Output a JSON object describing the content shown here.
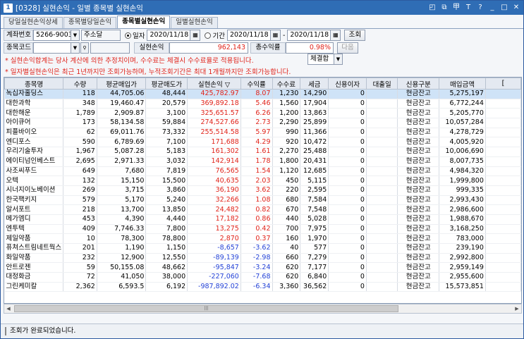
{
  "window": {
    "title": "[0328] 실현손익 - 일별 종목별 실현손익",
    "app_badge": "1"
  },
  "titlebar_icons": [
    "restore-icon",
    "copy-icon",
    "pin-icon",
    "font-icon",
    "help-icon",
    "minimize-icon",
    "maximize-icon",
    "close-icon"
  ],
  "titlebar_glyphs": {
    "t1": "◰",
    "t2": "⧉",
    "t3": "甲",
    "t4": "T",
    "t5": "?",
    "min": "_",
    "max": "□",
    "close": "✕"
  },
  "tabs": [
    {
      "label": "당일실현손익상세"
    },
    {
      "label": "종목별당일손익"
    },
    {
      "label": "종목별실현손익",
      "active": true
    },
    {
      "label": "일별실현손익"
    }
  ],
  "filters": {
    "account_label": "계좌번호",
    "account_value": "5266-9003",
    "account_holder": "주소달",
    "radio_daily": "일자",
    "radio_period": "기간",
    "daily_date": "2020/11/18",
    "period_from": "2020/11/18",
    "period_sep": "-",
    "period_to": "2020/11/18",
    "query_button": "조회",
    "next_button": "다음",
    "stock_code_label": "종목코드",
    "stock_code_value": "",
    "realized_label": "실현손익",
    "realized_value": "962,143",
    "return_label": "총수익률",
    "return_value": "0.98%",
    "price_type": "체결합"
  },
  "notices": [
    "* 실현손익합계는 당사 계산에 의한 추정치이며, 수수료는 체결시 수수료율로 적용됩니다.",
    "* 일자별실현손익은 최근 1년까지만 조회가능하며, 누적조회기간은 최대 1개월까지만 조회가능합니다."
  ],
  "table": {
    "columns": [
      "종목명",
      "수량",
      "평균매입가",
      "평균매도가",
      "실현손익",
      "수익률",
      "수수료",
      "세금",
      "신용이자",
      "대출일",
      "신용구분",
      "매입금액"
    ],
    "sort_indicator": "▽",
    "rows": [
      [
        "녹십자홀딩스",
        "118",
        "44,705.06",
        "48,444",
        "425,782.97",
        "8.07",
        "1,230",
        "14,290",
        "0",
        "",
        "현금잔고",
        "5,275,197"
      ],
      [
        "대한과학",
        "348",
        "19,460.47",
        "20,579",
        "369,892.18",
        "5.46",
        "1,560",
        "17,904",
        "0",
        "",
        "현금잔고",
        "6,772,244"
      ],
      [
        "대한해운",
        "1,789",
        "2,909.87",
        "3,100",
        "325,651.57",
        "6.26",
        "1,200",
        "13,863",
        "0",
        "",
        "현금잔고",
        "5,205,770"
      ],
      [
        "아이큐어",
        "173",
        "58,134.58",
        "59,884",
        "274,527.66",
        "2.73",
        "2,290",
        "25,899",
        "0",
        "",
        "현금잔고",
        "10,057,284"
      ],
      [
        "피플바이오",
        "62",
        "69,011.76",
        "73,332",
        "255,514.58",
        "5.97",
        "990",
        "11,366",
        "0",
        "",
        "현금잔고",
        "4,278,729"
      ],
      [
        "엔디포스",
        "590",
        "6,789.69",
        "7,100",
        "171,688",
        "4.29",
        "920",
        "10,472",
        "0",
        "",
        "현금잔고",
        "4,005,920"
      ],
      [
        "우리기술투자",
        "1,967",
        "5,087.28",
        "5,183",
        "161,302",
        "1.61",
        "2,270",
        "25,488",
        "0",
        "",
        "현금잔고",
        "10,006,690"
      ],
      [
        "에이티넘인베스트",
        "2,695",
        "2,971.33",
        "3,032",
        "142,914",
        "1.78",
        "1,800",
        "20,431",
        "0",
        "",
        "현금잔고",
        "8,007,735"
      ],
      [
        "사조씨푸드",
        "649",
        "7,680",
        "7,819",
        "76,565",
        "1.54",
        "1,120",
        "12,685",
        "0",
        "",
        "현금잔고",
        "4,984,320"
      ],
      [
        "오텍",
        "132",
        "15,150",
        "15,500",
        "40,635",
        "2.03",
        "450",
        "5,115",
        "0",
        "",
        "현금잔고",
        "1,999,800"
      ],
      [
        "시너지이노베이션",
        "269",
        "3,715",
        "3,860",
        "36,190",
        "3.62",
        "220",
        "2,595",
        "0",
        "",
        "현금잔고",
        "999,335"
      ],
      [
        "한국팩키지",
        "579",
        "5,170",
        "5,240",
        "32,266",
        "1.08",
        "680",
        "7,584",
        "0",
        "",
        "현금잔고",
        "2,993,430"
      ],
      [
        "알서포트",
        "218",
        "13,700",
        "13,850",
        "24,482",
        "0.82",
        "670",
        "7,548",
        "0",
        "",
        "현금잔고",
        "2,986,600"
      ],
      [
        "메가엠디",
        "453",
        "4,390",
        "4,440",
        "17,182",
        "0.86",
        "440",
        "5,028",
        "0",
        "",
        "현금잔고",
        "1,988,670"
      ],
      [
        "엔투텍",
        "409",
        "7,746.33",
        "7,800",
        "13,275",
        "0.42",
        "700",
        "7,975",
        "0",
        "",
        "현금잔고",
        "3,168,250"
      ],
      [
        "제일약품",
        "10",
        "78,300",
        "78,800",
        "2,870",
        "0.37",
        "160",
        "1,970",
        "0",
        "",
        "현금잔고",
        "783,000"
      ],
      [
        "퓨쳐스트림네트웍스",
        "201",
        "1,190",
        "1,150",
        "-8,657",
        "-3.62",
        "40",
        "577",
        "0",
        "",
        "현금잔고",
        "239,190"
      ],
      [
        "화일약품",
        "232",
        "12,900",
        "12,550",
        "-89,139",
        "-2.98",
        "660",
        "7,279",
        "0",
        "",
        "현금잔고",
        "2,992,800"
      ],
      [
        "안트로젠",
        "59",
        "50,155.08",
        "48,662",
        "-95,847",
        "-3.24",
        "620",
        "7,177",
        "0",
        "",
        "현금잔고",
        "2,959,149"
      ],
      [
        "대정화금",
        "72",
        "41,050",
        "38,000",
        "-227,060",
        "-7.68",
        "620",
        "6,840",
        "0",
        "",
        "현금잔고",
        "2,955,600"
      ],
      [
        "그린케미칼",
        "2,362",
        "6,593.5",
        "6,192",
        "-987,892.02",
        "-6.34",
        "3,360",
        "36,562",
        "0",
        "",
        "현금잔고",
        "15,573,851"
      ]
    ]
  },
  "status": {
    "text": "조회가 완료되었습니다."
  },
  "colors": {
    "title_bar": "#2f6db5",
    "profit": "#e0231a",
    "loss": "#2342d6",
    "selected_row": "#cfe3f7"
  }
}
